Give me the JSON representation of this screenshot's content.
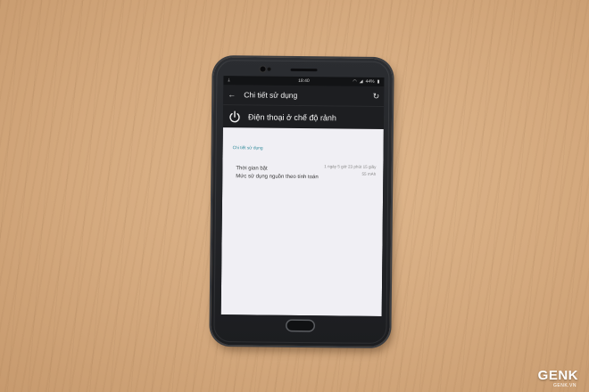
{
  "status_bar": {
    "time": "18:40",
    "battery": "44%",
    "icons": [
      "download-icon",
      "wifi-icon",
      "signal-icon",
      "battery-icon"
    ]
  },
  "app_bar": {
    "title": "Chi tiết sử dụng",
    "back_icon": "back-arrow-icon",
    "refresh_icon": "refresh-icon"
  },
  "header": {
    "icon": "power-icon",
    "title": "Điện thoại ở chế độ rảnh"
  },
  "details": {
    "section_label": "Chi tiết sử dụng",
    "rows": [
      {
        "label": "Thời gian bật",
        "value": "1 ngày 5 giờ 23 phút 15 giây"
      },
      {
        "label": "Mức sử dụng nguồn theo tính toán",
        "value": "55 mAh"
      }
    ]
  },
  "watermark": {
    "brand": "GENK",
    "domain": "GENK.VN"
  },
  "colors": {
    "table": "#d4a97e",
    "phone_body": "#1c1d20",
    "screen_bg": "#f0eff4",
    "accent": "#2e8a9a"
  }
}
